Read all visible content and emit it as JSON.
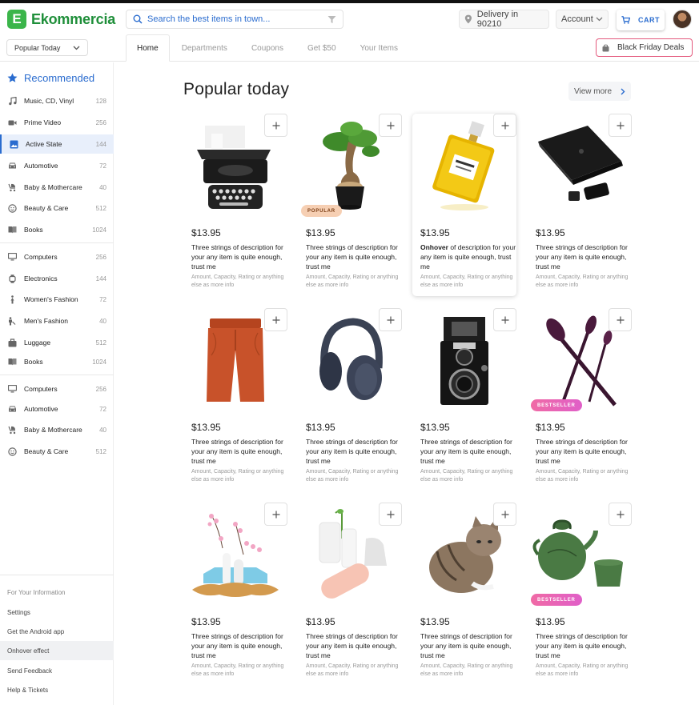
{
  "app": {
    "logo_letter": "E",
    "name": "Ekommercia",
    "brand_color": "#3bb54a",
    "accent_color": "#2a6ccf"
  },
  "header": {
    "search_placeholder": "Search the best items in town...",
    "delivery": "Delivery in 90210",
    "account": "Account",
    "cart": "CART"
  },
  "subheader": {
    "sort": "Popular Today",
    "tabs": [
      "Home",
      "Departments",
      "Coupons",
      "Get $50",
      "Your Items"
    ],
    "active_tab": "Home",
    "deals": "Black Friday Deals"
  },
  "sidebar": {
    "heading": "Recommended",
    "items": [
      {
        "label": "Music, CD, Vinyl",
        "count": "128",
        "icon": "music-note-icon"
      },
      {
        "label": "Prime Video",
        "count": "256",
        "icon": "video-camera-icon"
      },
      {
        "label": "Active State",
        "count": "144",
        "icon": "image-icon",
        "active": true
      },
      {
        "label": "Automotive",
        "count": "72",
        "icon": "car-icon"
      },
      {
        "label": "Baby & Mothercare",
        "count": "40",
        "icon": "stroller-icon"
      },
      {
        "label": "Beauty & Care",
        "count": "512",
        "icon": "face-icon"
      },
      {
        "label": "Books",
        "count": "1024",
        "icon": "book-icon"
      },
      {
        "label": "Computers",
        "count": "256",
        "icon": "monitor-icon"
      },
      {
        "label": "Electronics",
        "count": "144",
        "icon": "watch-icon"
      },
      {
        "label": "Women's Fashion",
        "count": "72",
        "icon": "woman-icon"
      },
      {
        "label": "Men's Fashion",
        "count": "40",
        "icon": "man-icon"
      },
      {
        "label": "Luggage",
        "count": "512",
        "icon": "luggage-icon"
      },
      {
        "label": "Books",
        "count": "1024",
        "icon": "book-icon"
      },
      {
        "label": "Computers",
        "count": "256",
        "icon": "monitor-icon"
      },
      {
        "label": "Automotive",
        "count": "72",
        "icon": "car-icon"
      },
      {
        "label": "Baby & Mothercare",
        "count": "40",
        "icon": "stroller-icon"
      },
      {
        "label": "Beauty & Care",
        "count": "512",
        "icon": "face-icon"
      }
    ],
    "info_title": "For Your Information",
    "links": [
      "Settings",
      "Get the Android app",
      "Onhover effect",
      "Send Feedback",
      "Help & Tickets"
    ]
  },
  "main": {
    "title": "Popular today",
    "view_more": "View more",
    "products": [
      {
        "name": "typewriter",
        "price": "$13.95",
        "desc": "Three strings of description for your any item is quite enough, trust me",
        "meta": "Amount, Capacity, Rating or anything else as more info"
      },
      {
        "name": "bonsai",
        "price": "$13.95",
        "desc": "Three strings of description for your any item is quite enough, trust me",
        "meta": "Amount, Capacity, Rating or anything else as more info",
        "badge": "POPULAR"
      },
      {
        "name": "perfume",
        "price": "$13.95",
        "desc_bold": "Onhover",
        "desc": " of description for your any item is quite enough, trust me",
        "meta": "Amount, Capacity, Rating or anything else as more info"
      },
      {
        "name": "laptop",
        "price": "$13.95",
        "desc": "Three strings of description for your any item is quite enough, trust me",
        "meta": "Amount, Capacity, Rating or anything else as more info"
      },
      {
        "name": "pants",
        "price": "$13.95",
        "desc": "Three strings of description for your any item is quite enough, trust me",
        "meta": "Amount, Capacity, Rating or anything else as more info"
      },
      {
        "name": "headphones",
        "price": "$13.95",
        "desc": "Three strings of description for your any item is quite enough, trust me",
        "meta": "Amount, Capacity, Rating or anything else as more info"
      },
      {
        "name": "camera",
        "price": "$13.95",
        "desc": "Three strings of description for your any item is quite enough, trust me",
        "meta": "Amount, Capacity, Rating or anything else as more info"
      },
      {
        "name": "brushes",
        "price": "$13.95",
        "desc": "Three strings of description for your any item is quite enough, trust me",
        "meta": "Amount, Capacity, Rating or anything else as more info",
        "badge": "BESTSELLER"
      },
      {
        "name": "vases",
        "price": "$13.95",
        "desc": "Three strings of description for your any item is quite enough, trust me",
        "meta": "Amount, Capacity, Rating or anything else as more info"
      },
      {
        "name": "ceramics",
        "price": "$13.95",
        "desc": "Three strings of description for your any item is quite enough, trust me",
        "meta": "Amount, Capacity, Rating or anything else as more info"
      },
      {
        "name": "cat",
        "price": "$13.95",
        "desc": "Three strings of description for your any item is quite enough, trust me",
        "meta": "Amount, Capacity, Rating or anything else as more info"
      },
      {
        "name": "teapot",
        "price": "$13.95",
        "desc": "Three strings of description for your any item is quite enough, trust me",
        "meta": "Amount, Capacity, Rating or anything else as more info",
        "badge": "BESTSELLER"
      }
    ]
  }
}
